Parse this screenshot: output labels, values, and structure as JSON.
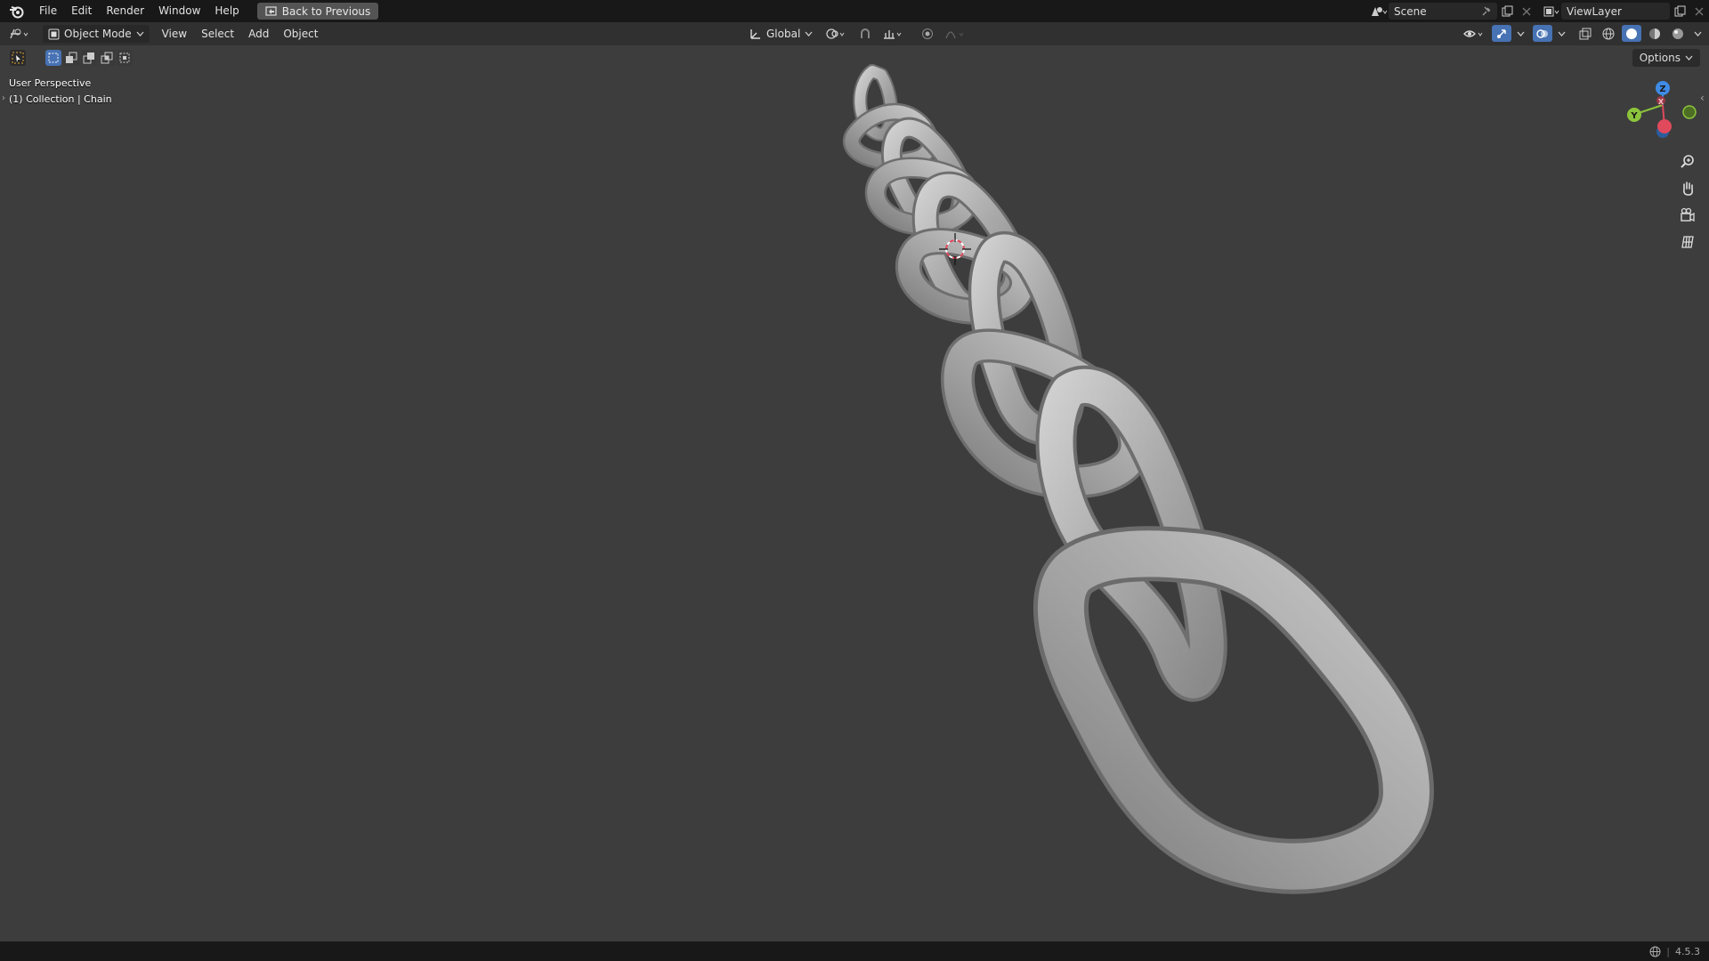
{
  "topbar": {
    "menu": [
      "File",
      "Edit",
      "Render",
      "Window",
      "Help"
    ],
    "back_button": "Back to Previous",
    "scene": "Scene",
    "view_layer": "ViewLayer"
  },
  "header": {
    "mode": "Object Mode",
    "menu": [
      "View",
      "Select",
      "Add",
      "Object"
    ],
    "orientation": "Global"
  },
  "viewport": {
    "view_name": "User Perspective",
    "collection": "(1) Collection | Chain",
    "options": "Options"
  },
  "gizmo": {
    "x": "X",
    "y": "Y",
    "z": "Z"
  },
  "status": {
    "version": "4.5.3"
  },
  "colors": {
    "accent": "#4772b3",
    "x_axis": "#e04a5c",
    "y_axis": "#8cc43c",
    "z_axis": "#3f8ce8"
  }
}
